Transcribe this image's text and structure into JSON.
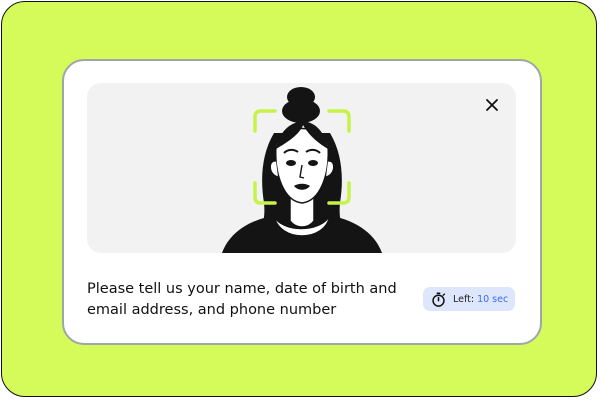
{
  "dialog": {
    "prompt_text": "Please tell us your name, date of birth and email address,  and phone number",
    "close_icon": "close-icon",
    "face_frame_color": "#c6f24a",
    "background_color": "#d4fb5a"
  },
  "timer": {
    "icon": "stopwatch-icon",
    "label": "Left:",
    "value": "10 sec",
    "accent_color": "#3b6bf0"
  }
}
